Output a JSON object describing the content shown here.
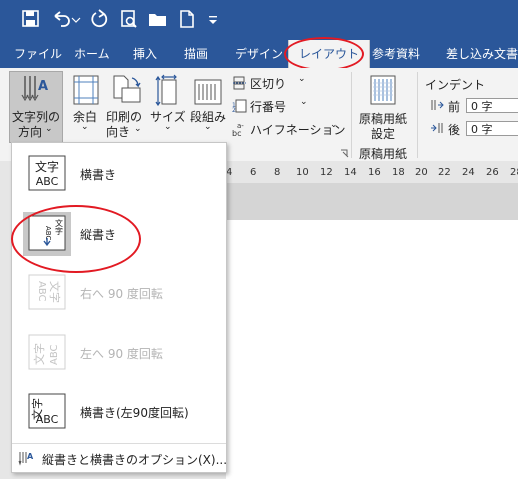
{
  "qat": {
    "icons": [
      "save-icon",
      "undo-icon",
      "redo-icon",
      "print-preview-icon",
      "open-folder-icon",
      "new-document-icon",
      "customize-qat-icon"
    ]
  },
  "tabs": [
    {
      "label": "ファイル",
      "active": false
    },
    {
      "label": "ホーム",
      "active": false
    },
    {
      "label": "挿入",
      "active": false
    },
    {
      "label": "描画",
      "active": false
    },
    {
      "label": "デザイン",
      "active": false
    },
    {
      "label": "レイアウト",
      "active": true
    },
    {
      "label": "参考資料",
      "active": false
    },
    {
      "label": "差し込み文書",
      "active": false
    }
  ],
  "ribbon": {
    "text_direction": {
      "line1": "文字列の",
      "line2": "方向"
    },
    "margins": {
      "line1": "余白"
    },
    "orientation": {
      "line1": "印刷の",
      "line2": "向き"
    },
    "size": {
      "line1": "サイズ"
    },
    "columns": {
      "line1": "段組み"
    },
    "breaks": "区切り",
    "line_numbers": "行番号",
    "hyphenation": "ハイフネーション",
    "genko": {
      "line1": "原稿用紙",
      "line2": "設定"
    },
    "genko_group": "原稿用紙",
    "indent": {
      "title": "インデント",
      "before_label": "前",
      "before_value": "0 字",
      "after_label": "後",
      "after_value": "0 字"
    }
  },
  "ruler": {
    "ticks": [
      "4",
      "6",
      "8",
      "10",
      "12",
      "14",
      "16",
      "18",
      "20",
      "22",
      "24",
      "26",
      "28"
    ]
  },
  "menu": {
    "items": [
      {
        "label": "横書き",
        "icon": "horizontal-text-icon",
        "enabled": true,
        "selected": false
      },
      {
        "label": "縦書き",
        "icon": "vertical-text-icon",
        "enabled": true,
        "selected": true
      },
      {
        "label": "右へ 90 度回転",
        "icon": "rotate-right-90-icon",
        "enabled": false,
        "selected": false
      },
      {
        "label": "左へ 90 度回転",
        "icon": "rotate-left-90-icon",
        "enabled": false,
        "selected": false
      },
      {
        "label": "横書き(左90度回転)",
        "icon": "horizontal-rotated-left-icon",
        "enabled": true,
        "selected": false
      }
    ],
    "options": "縦書きと横書きのオプション(X)...",
    "icon_texts": {
      "moji": "文字",
      "abc": "ABC"
    }
  },
  "colors": {
    "ribbon_blue": "#2b579a",
    "annotation_red": "#e21a23",
    "selected_gray": "#c8c8c8"
  }
}
